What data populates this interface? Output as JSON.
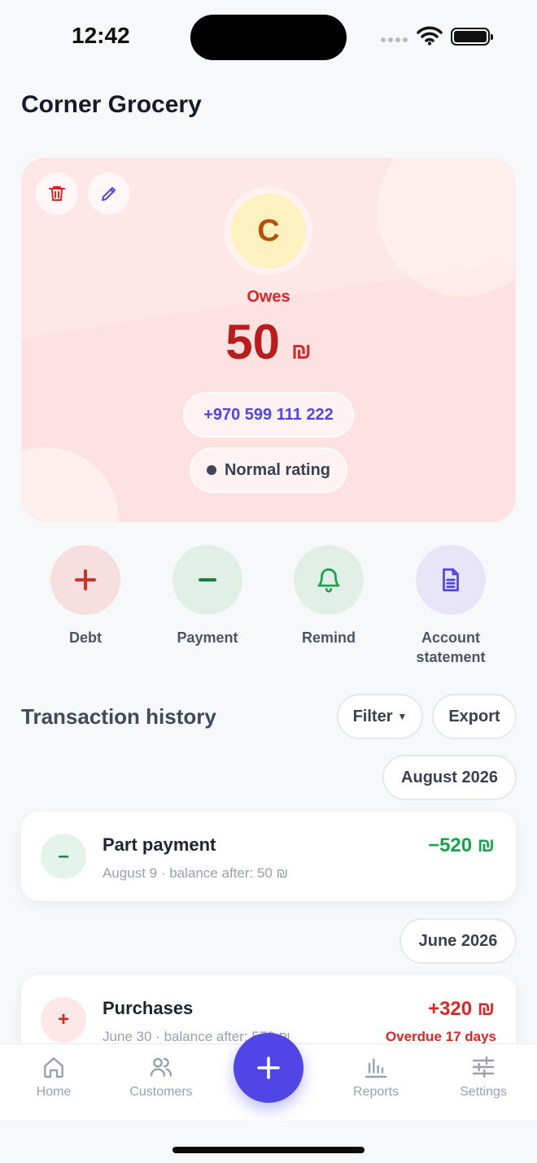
{
  "status_bar": {
    "time": "12:42"
  },
  "header": {
    "title": "Corner Grocery"
  },
  "customer": {
    "initial": "C",
    "status_label": "Owes",
    "balance": "50",
    "currency": "₪",
    "phone": "+970 599 111 222",
    "rating": "Normal rating",
    "colors": {
      "card_bg": "#fee2e2",
      "balance": "#b91c1c",
      "avatar_bg": "#fdf1c0"
    }
  },
  "actions": [
    {
      "label": "Debt",
      "icon": "plus-icon",
      "color": "#c0392b"
    },
    {
      "label": "Payment",
      "icon": "minus-icon",
      "color": "#15803d"
    },
    {
      "label": "Remind",
      "icon": "bell-icon",
      "color": "#16a34a"
    },
    {
      "label": "Account statement",
      "icon": "document-icon",
      "color": "#4f46e5"
    }
  ],
  "history": {
    "title": "Transaction history",
    "filter_label": "Filter",
    "export_label": "Export",
    "groups": [
      {
        "month": "August 2026",
        "items": [
          {
            "title": "Part payment",
            "subtitle": "August 9 · balance after: 50 ₪",
            "amount": "−520 ₪",
            "amount_color": "#16a34a",
            "note": ""
          }
        ]
      },
      {
        "month": "June 2026",
        "items": [
          {
            "title": "Purchases",
            "subtitle": "June 30 · balance after: 570 ₪",
            "amount": "+320 ₪",
            "amount_color": "#dc2626",
            "note": "Overdue 17 days"
          }
        ]
      }
    ]
  },
  "tabbar": {
    "items": [
      {
        "label": "Home",
        "icon": "home-icon"
      },
      {
        "label": "Customers",
        "icon": "users-icon"
      },
      {
        "label": "Reports",
        "icon": "bar-chart-icon"
      },
      {
        "label": "Settings",
        "icon": "sliders-icon"
      }
    ],
    "fab_icon": "plus-icon",
    "accent": "#4f46e5"
  }
}
